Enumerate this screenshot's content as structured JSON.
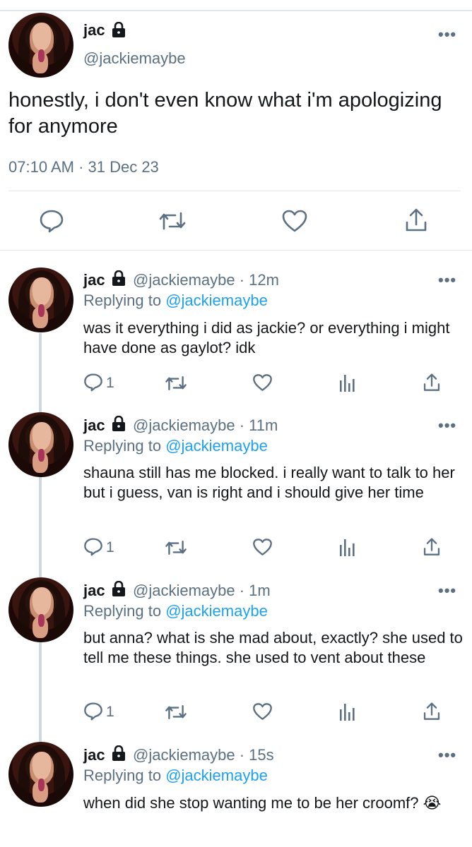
{
  "main_tweet": {
    "name": "jac",
    "handle": "@jackiemaybe",
    "text": "honestly, i don't even know what i'm apologizing for anymore",
    "timestamp": "07:10 AM · 31 Dec 23",
    "more": "•••"
  },
  "replies": [
    {
      "name": "jac",
      "handle_time": "@jackiemaybe · 12m",
      "replying_label": "Replying to ",
      "replying_to": "@jackiemaybe",
      "text": "was it everything i did as jackie? or everything i might have done as gaylot? idk",
      "reply_count": "1",
      "more": "•••"
    },
    {
      "name": "jac",
      "handle_time": "@jackiemaybe · 11m",
      "replying_label": "Replying to ",
      "replying_to": "@jackiemaybe",
      "text": "shauna still has me blocked. i really want to talk to her but i guess, van is right and i should give her time",
      "reply_count": "1",
      "more": "•••"
    },
    {
      "name": "jac",
      "handle_time": "@jackiemaybe · 1m",
      "replying_label": "Replying to ",
      "replying_to": "@jackiemaybe",
      "text": "but anna? what is she mad about, exactly? she used to tell me these things. she used to vent about these",
      "reply_count": "1",
      "more": "•••"
    },
    {
      "name": "jac",
      "handle_time": "@jackiemaybe · 15s",
      "replying_label": "Replying to ",
      "replying_to": "@jackiemaybe",
      "text": "when did she stop wanting me to be her croomf? 😭",
      "more": "•••"
    }
  ],
  "colors": {
    "accent": "#1da1f2",
    "secondary_text": "#5b7083",
    "divider": "#e1e8ed"
  },
  "icons": [
    "lock-icon",
    "reply-icon",
    "retweet-icon",
    "like-icon",
    "share-icon",
    "analytics-icon",
    "more-icon"
  ]
}
